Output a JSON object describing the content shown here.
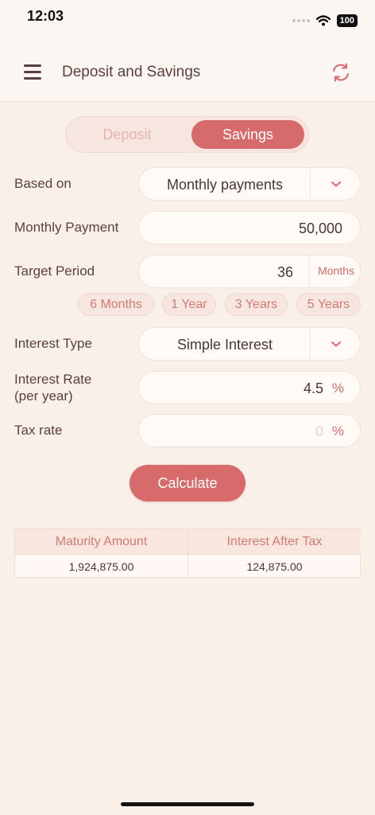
{
  "status": {
    "time": "12:03",
    "battery": "100"
  },
  "header": {
    "title": "Deposit and Savings"
  },
  "segment": {
    "deposit": "Deposit",
    "savings": "Savings",
    "selected": "Savings"
  },
  "form": {
    "based_on": {
      "label": "Based on",
      "value": "Monthly payments"
    },
    "monthly_payment": {
      "label": "Monthly Payment",
      "value": "50,000"
    },
    "target_period": {
      "label": "Target Period",
      "value": "36",
      "unit": "Months"
    },
    "period_chips": [
      "6 Months",
      "1 Year",
      "3 Years",
      "5 Years"
    ],
    "interest_type": {
      "label": "Interest Type",
      "value": "Simple Interest"
    },
    "interest_rate": {
      "label_line1": "Interest Rate",
      "label_line2": "(per year)",
      "value": "4.5",
      "unit": "%"
    },
    "tax_rate": {
      "label": "Tax rate",
      "placeholder": "0",
      "unit": "%"
    },
    "calculate_label": "Calculate"
  },
  "result": {
    "headers": [
      "Maturity Amount",
      "Interest After Tax"
    ],
    "values": [
      "1,924,875.00",
      "124,875.00"
    ]
  },
  "colors": {
    "accent": "#d76b6b",
    "background": "#faf0ea",
    "text": "#5b3f3c"
  },
  "icons": {
    "menu": "hamburger-menu-icon",
    "refresh": "refresh-icon",
    "dropdown": "chevron-down-icon",
    "wifi": "wifi-icon"
  }
}
